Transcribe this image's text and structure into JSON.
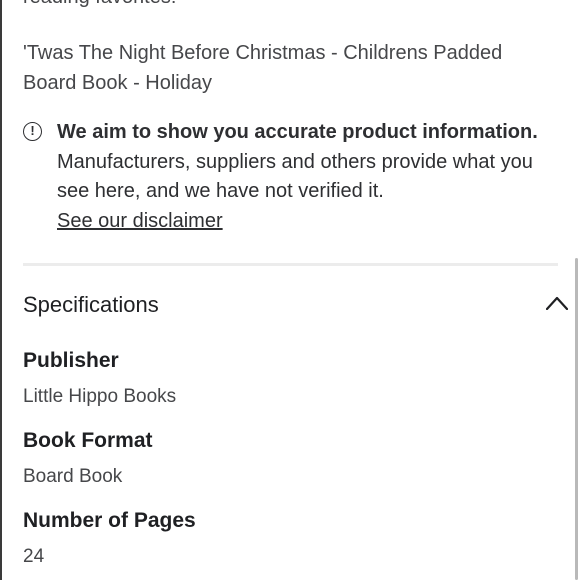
{
  "description": {
    "tail_text": "reading favorites!"
  },
  "product": {
    "title": "'Twas The Night Before Christmas - Childrens Padded Board Book - Holiday"
  },
  "info_notice": {
    "icon": "info-circle-icon",
    "heading": "We aim to show you accurate product information.",
    "body": "Manufacturers, suppliers and others provide what you see here, and we have not verified it.",
    "link_label": "See our disclaimer"
  },
  "specifications": {
    "title": "Specifications",
    "toggle_icon": "chevron-up-icon",
    "items": [
      {
        "label": "Publisher",
        "value": "Little Hippo Books"
      },
      {
        "label": "Book Format",
        "value": "Board Book"
      },
      {
        "label": "Number of Pages",
        "value": "24"
      }
    ]
  }
}
